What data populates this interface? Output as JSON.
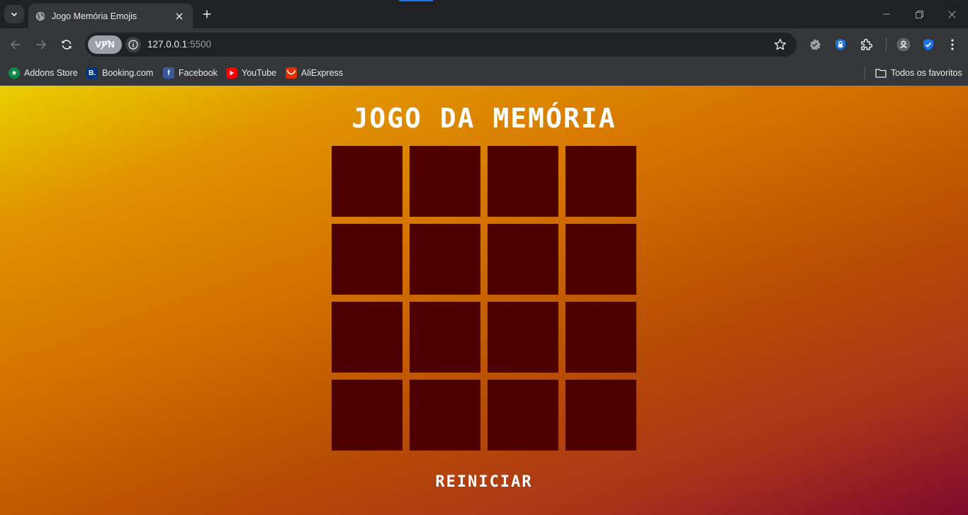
{
  "browser": {
    "tab": {
      "title": "Jogo Memória Emojis"
    },
    "address_bar": {
      "vpn_label": "VPN",
      "url_host": "127.0.0.1",
      "url_port": ":5500"
    },
    "bookmarks": [
      {
        "label": "Addons Store",
        "icon": "addons-store-icon",
        "color": "#0a8a48"
      },
      {
        "label": "Booking.com",
        "icon": "booking-icon",
        "color": "#003580"
      },
      {
        "label": "Facebook",
        "icon": "facebook-icon",
        "color": "#3b5998"
      },
      {
        "label": "YouTube",
        "icon": "youtube-icon",
        "color": "#ff0000"
      },
      {
        "label": "AliExpress",
        "icon": "aliexpress-icon",
        "color": "#e62e04"
      }
    ],
    "all_bookmarks_label": "Todos os favoritos"
  },
  "game": {
    "title": "JOGO DA MEMÓRIA",
    "card_back_color": "#4f0100",
    "cards_face_down": 16,
    "reset_label": "REINICIAR"
  }
}
